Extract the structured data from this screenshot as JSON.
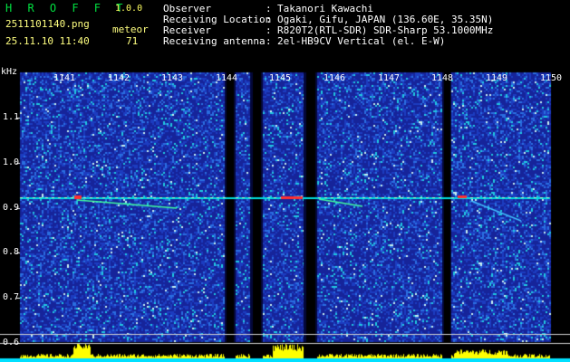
{
  "header": {
    "app_title": "H R O F F T",
    "version": "1.0.0",
    "filename": "2511101140.png",
    "datetime": "25.11.10 11:40",
    "mode_label": "meteor",
    "count": "71",
    "info_rows": [
      {
        "key": "Observer",
        "sep": ":",
        "value": "Takanori Kawachi"
      },
      {
        "key": "Receiving Location",
        "sep": ":",
        "value": "Ogaki, Gifu, JAPAN (136.60E, 35.35N)"
      },
      {
        "key": "Receiver",
        "sep": ":",
        "value": "R820T2(RTL-SDR) SDR-Sharp 53.1000MHz"
      },
      {
        "key": "Receiving antenna",
        "sep": ":",
        "value": "2el-HB9CV Vertical (el. E-W)"
      }
    ]
  },
  "axes": {
    "y_unit": "kHz",
    "y_ticks": [
      "1.1",
      "1.0",
      "0.9",
      "0.8",
      "0.7",
      "0.6"
    ],
    "x_ticks": [
      "1141",
      "1142",
      "1143",
      "1144",
      "1145",
      "1146",
      "1147",
      "1148",
      "1149",
      "1150"
    ]
  },
  "colors": {
    "background": "#000000",
    "noise_base": "#1a2a9a",
    "carrier": "#00e0e0",
    "meteor": "#ff3030",
    "signal_bars": "#ffff00",
    "noise_floor": "#00e0ff",
    "header_green": "#00e040",
    "header_yellow": "#ffff80"
  }
}
